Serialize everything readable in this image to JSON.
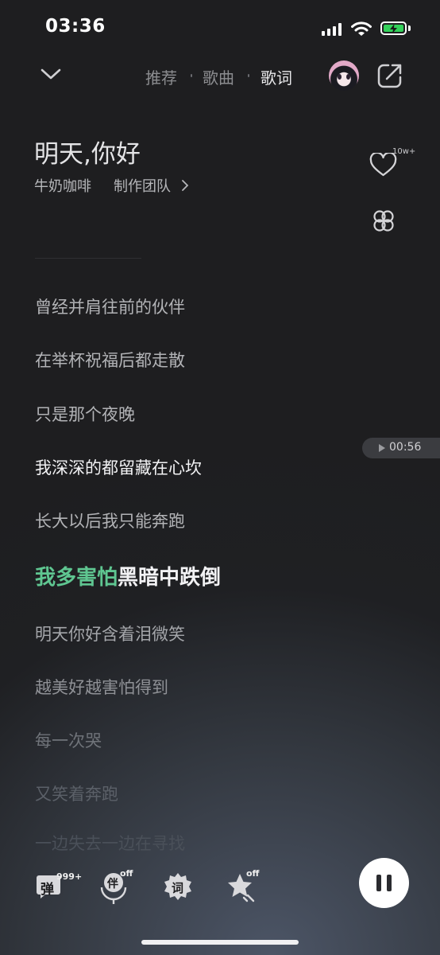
{
  "status_bar": {
    "time": "03:36"
  },
  "header": {
    "tabs": [
      {
        "label": "推荐",
        "active": false
      },
      {
        "label": "歌曲",
        "active": false
      },
      {
        "label": "歌词",
        "active": true
      }
    ]
  },
  "song": {
    "title": "明天,你好",
    "artist": "牛奶咖啡",
    "credit_link": "制作团队",
    "likes": "10w+"
  },
  "lyrics": {
    "lines": [
      "曾经并肩往前的伙伴",
      "在举杯祝福后都走散",
      "只是那个夜晚",
      "我深深的都留藏在心坎",
      "长大以后我只能奔跑"
    ],
    "current_sung": "我多害怕",
    "current_rest": "黑暗中跌倒",
    "upcoming": [
      "明天你好含着泪微笑",
      "越美好越害怕得到",
      "每一次哭",
      "又笑着奔跑",
      "一边失去一边在寻找"
    ],
    "seek_time": "00:56"
  },
  "controls": {
    "danmaku_label": "弹",
    "danmaku_count": "999+",
    "accompany_label": "伴",
    "accompany_state": "off",
    "lyric_label": "词",
    "star_state": "off"
  },
  "colors": {
    "accent_green": "#5fc691",
    "battery_green": "#33d15a"
  }
}
